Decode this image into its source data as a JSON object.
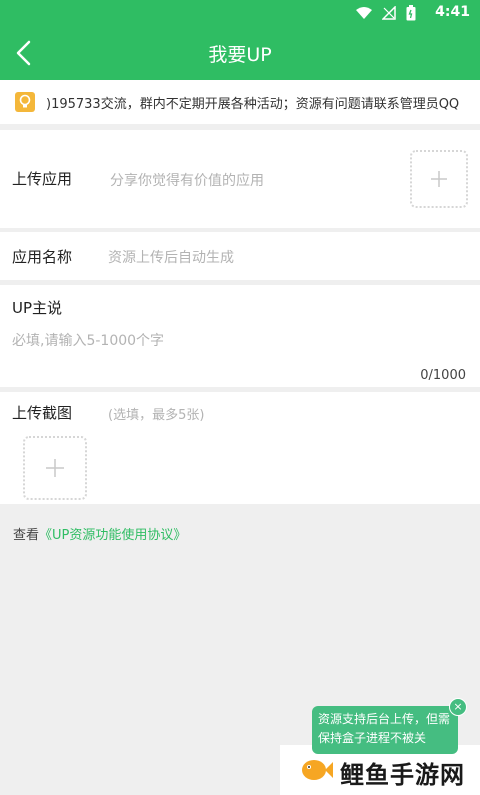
{
  "status_bar": {
    "time": "4:41"
  },
  "app_bar": {
    "title": "我要UP"
  },
  "notice": {
    "text": ")195733交流，群内不定期开展各种活动；资源有问题请联系管理员QQ"
  },
  "upload_app": {
    "label": "上传应用",
    "hint": "分享你觉得有价值的应用"
  },
  "app_name": {
    "label": "应用名称",
    "placeholder": "资源上传后自动生成"
  },
  "up_says": {
    "label": "UP主说",
    "placeholder": "必填,请输入5-1000个字",
    "counter": "0/1000"
  },
  "screenshots": {
    "label": "上传截图",
    "hint": "(选填，最多5张)"
  },
  "agreement": {
    "prefix": "查看",
    "link": "《UP资源功能使用协议》"
  },
  "toast": {
    "text": "资源支持后台上传，但需保持盒子进程不被关"
  },
  "watermark": {
    "brand": "鲤鱼手游网"
  },
  "colors": {
    "primary": "#2fbd63",
    "toast": "#45bd81",
    "background": "#efefef"
  }
}
